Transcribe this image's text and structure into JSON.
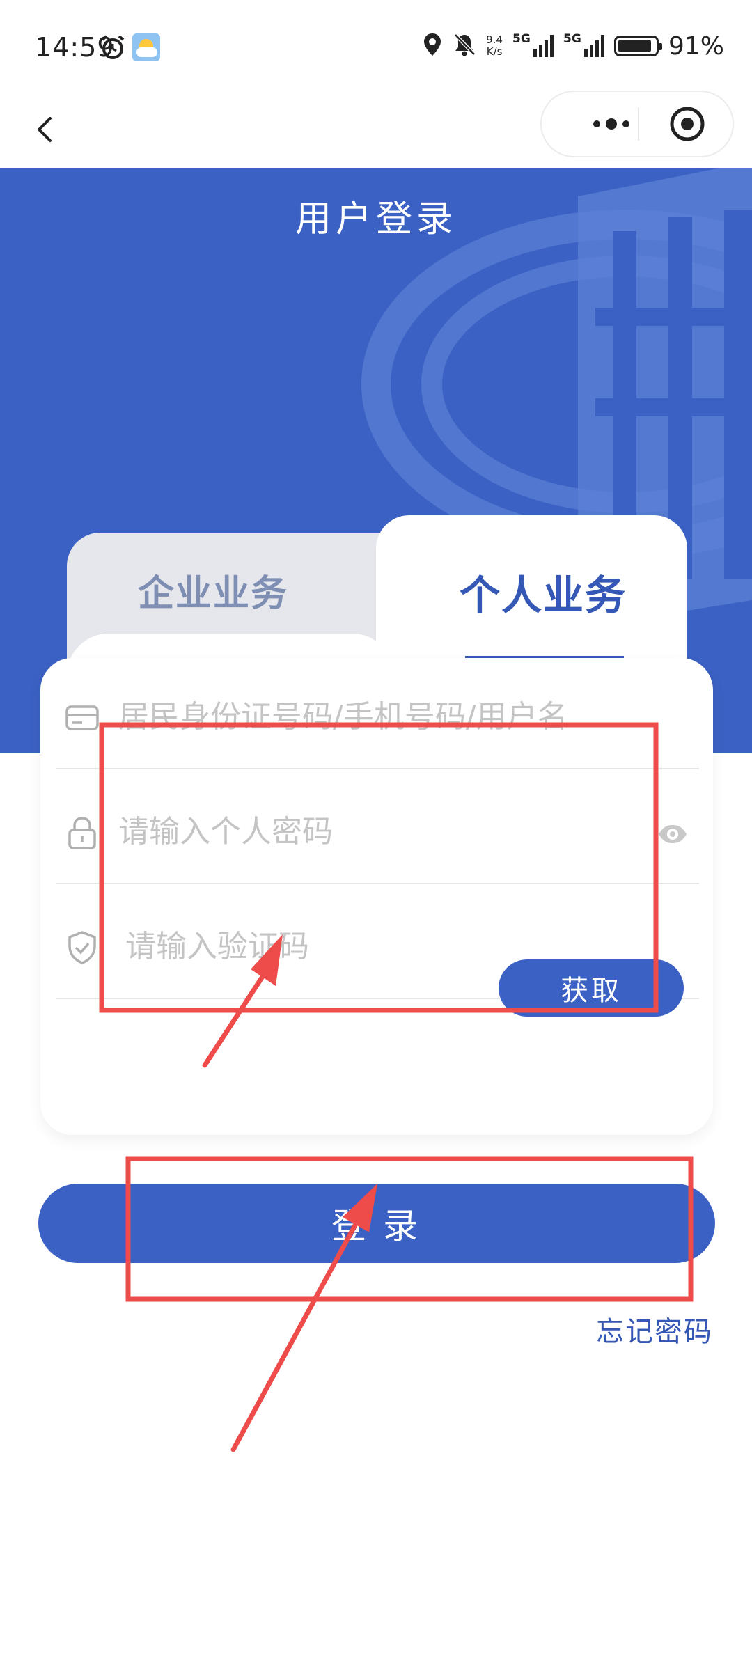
{
  "status_bar": {
    "time": "14:59",
    "net_speed_value": "9.4",
    "net_speed_unit": "K/s",
    "sim1": "5G",
    "sim2": "5G",
    "battery_text": "91%",
    "battery_level": 0.91
  },
  "page": {
    "title": "用户登录"
  },
  "tabs": [
    {
      "label": "企业业务",
      "active": false
    },
    {
      "label": "个人业务",
      "active": true
    }
  ],
  "form": {
    "account_placeholder": "居民身份证号码/手机号码/用户名",
    "password_placeholder": "请输入个人密码",
    "code_placeholder": "请输入验证码",
    "get_code_label": "获取"
  },
  "actions": {
    "login_label": "登录",
    "forgot_label": "忘记密码"
  },
  "icons": {
    "back": "chevron-left-icon",
    "more": "more-dots-icon",
    "close_miniprogram": "target-circle-icon",
    "account": "id-card-icon",
    "password": "lock-icon",
    "code": "shield-check-icon",
    "eye": "eye-icon"
  },
  "colors": {
    "brand_blue": "#3b61c4",
    "tab_active_text": "#3558b6",
    "tab_inactive_text": "#7f8fb3",
    "annotation_red": "#ee4b4b"
  }
}
